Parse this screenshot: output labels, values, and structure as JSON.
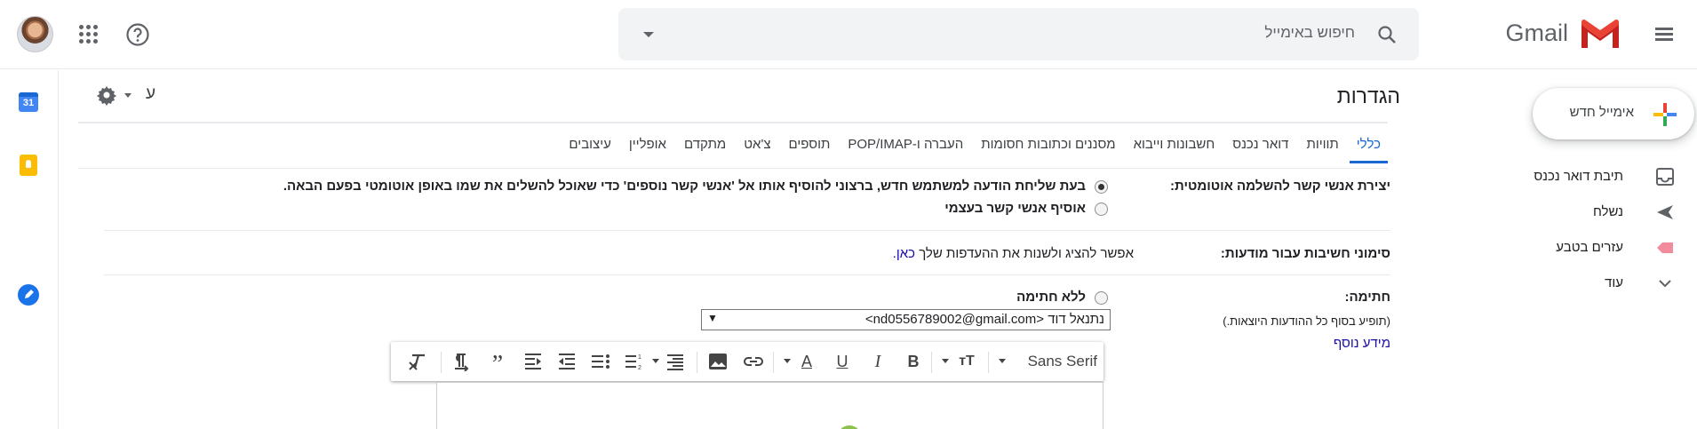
{
  "header": {
    "app_name": "Gmail",
    "search_placeholder": "חיפוש באימייל"
  },
  "nav": {
    "compose_label": "אימייל חדש",
    "items": [
      {
        "label": "תיבת דואר נכנס",
        "icon": "inbox-icon"
      },
      {
        "label": "נשלח",
        "icon": "send-icon"
      },
      {
        "label": "עזרים בטבע",
        "icon": "label-icon"
      },
      {
        "label": "עוד",
        "icon": "chevron-down-icon"
      }
    ]
  },
  "side_panel": {
    "calendar_day": "31"
  },
  "settings": {
    "title": "הגדרות",
    "language_indicator": "ע",
    "tabs": [
      "כללי",
      "תוויות",
      "דואר נכנס",
      "חשבונות וייבוא",
      "מסננים וכתובות חסומות",
      "העברה ו-POP/IMAP",
      "תוספים",
      "צ'אט",
      "מתקדם",
      "אופליין",
      "עיצובים"
    ],
    "active_tab": "כללי",
    "auto_contacts": {
      "label": "יצירת אנשי קשר להשלמה אוטומטית:",
      "option1": "בעת שליחת הודעה למשתמש חדש, ברצוני להוסיף אותו אל 'אנשי קשר נוספים' כדי שאוכל להשלים את שמו באופן אוטומטי בפעם הבאה.",
      "option2": "אוסיף אנשי קשר בעצמי",
      "selected": 1
    },
    "importance": {
      "label": "סימוני חשיבות עבור מודעות:",
      "text": "אפשר להציג ולשנות את ההעדפות שלך",
      "link": "כאן."
    },
    "signature": {
      "label": "חתימה:",
      "sublabel": "(תופיע בסוף כל ההודעות היוצאות.)",
      "more_info": "מידע נוסף",
      "option_none": "ללא חתימה",
      "selected_account": "נתנאל דוד <nd0556789002@gmail.com>",
      "selected": 2
    },
    "editor": {
      "font_name": "Sans Serif"
    }
  },
  "colors": {
    "accent": "#1967d2",
    "compose_plus": [
      "#ea4335",
      "#fbbc04",
      "#34a853",
      "#4285f4"
    ]
  }
}
